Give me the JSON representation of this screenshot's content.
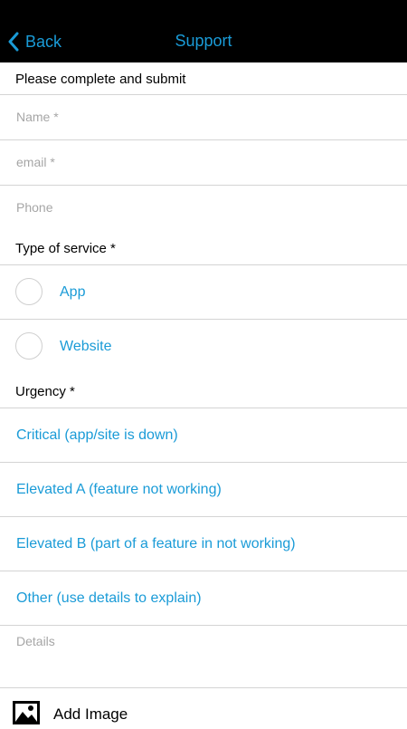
{
  "nav": {
    "back_label": "Back",
    "title": "Support",
    "accent_color": "#1a9bd7"
  },
  "form": {
    "intro": "Please complete and submit",
    "name_placeholder": "Name *",
    "email_placeholder": "email *",
    "phone_placeholder": "Phone",
    "service_label": "Type of service *",
    "service_options": [
      "App",
      "Website"
    ],
    "urgency_label": "Urgency *",
    "urgency_options": [
      "Critical (app/site is down)",
      "Elevated A (feature not working)",
      "Elevated B (part of a feature in not working)",
      "Other (use details to explain)"
    ],
    "details_placeholder": "Details",
    "add_image_label": "Add Image",
    "icons": [
      "chevron-left-icon",
      "image-icon"
    ]
  }
}
